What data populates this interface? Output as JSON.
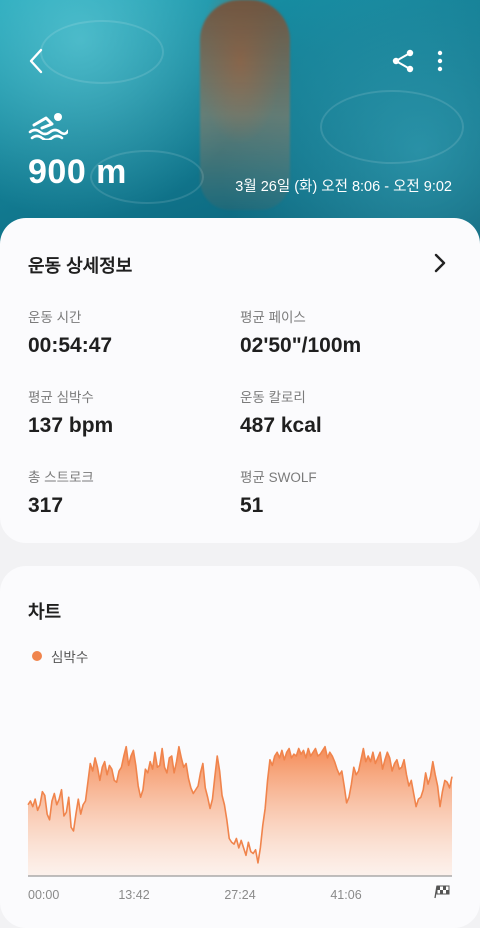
{
  "header": {
    "distance": "900 m",
    "date_range": "3월 26일 (화) 오전 8:06 - 오전 9:02",
    "icons": [
      "back-arrow-icon",
      "share-icon",
      "more-options-icon",
      "swimming-icon"
    ]
  },
  "details": {
    "title": "운동 상세정보",
    "metrics": [
      {
        "label": "운동 시간",
        "value": "00:54:47"
      },
      {
        "label": "평균 페이스",
        "value": "02'50\"/100m"
      },
      {
        "label": "평균 심박수",
        "value": "137 bpm"
      },
      {
        "label": "운동 칼로리",
        "value": "487 kcal"
      },
      {
        "label": "총 스트로크",
        "value": "317"
      },
      {
        "label": "평균 SWOLF",
        "value": "51"
      }
    ]
  },
  "chart_section": {
    "title": "차트",
    "legend_label": "심박수"
  },
  "chart_data": {
    "type": "area",
    "series": [
      {
        "name": "심박수",
        "color": "#f0844c",
        "values": [
          118,
          120,
          117,
          121,
          115,
          118,
          125,
          123,
          113,
          110,
          120,
          124,
          118,
          121,
          126,
          112,
          114,
          122,
          106,
          104,
          113,
          121,
          113,
          118,
          120,
          130,
          140,
          136,
          143,
          138,
          131,
          138,
          141,
          134,
          139,
          137,
          131,
          130,
          136,
          138,
          144,
          149,
          139,
          144,
          147,
          139,
          128,
          122,
          126,
          137,
          135,
          141,
          137,
          146,
          138,
          139,
          148,
          138,
          135,
          143,
          144,
          135,
          141,
          149,
          143,
          138,
          140,
          132,
          127,
          124,
          126,
          128,
          135,
          140,
          127,
          122,
          116,
          121,
          133,
          144,
          136,
          123,
          118,
          110,
          100,
          98,
          97,
          100,
          95,
          99,
          95,
          91,
          98,
          93,
          92,
          94,
          87,
          95,
          107,
          116,
          131,
          142,
          139,
          144,
          146,
          143,
          147,
          142,
          146,
          148,
          143,
          145,
          144,
          148,
          145,
          147,
          143,
          148,
          144,
          146,
          148,
          144,
          145,
          147,
          149,
          143,
          146,
          144,
          141,
          137,
          134,
          136,
          128,
          119,
          122,
          129,
          138,
          134,
          136,
          142,
          148,
          141,
          144,
          141,
          146,
          140,
          143,
          146,
          137,
          142,
          146,
          143,
          136,
          140,
          142,
          137,
          138,
          142,
          134,
          128,
          131,
          124,
          117,
          121,
          122,
          126,
          135,
          129,
          133,
          141,
          134,
          128,
          117,
          125,
          131,
          130,
          127,
          133
        ]
      }
    ],
    "x_ticks": [
      "00:00",
      "13:42",
      "27:24",
      "41:06"
    ],
    "ylim": [
      80,
      160
    ],
    "grid": false
  }
}
